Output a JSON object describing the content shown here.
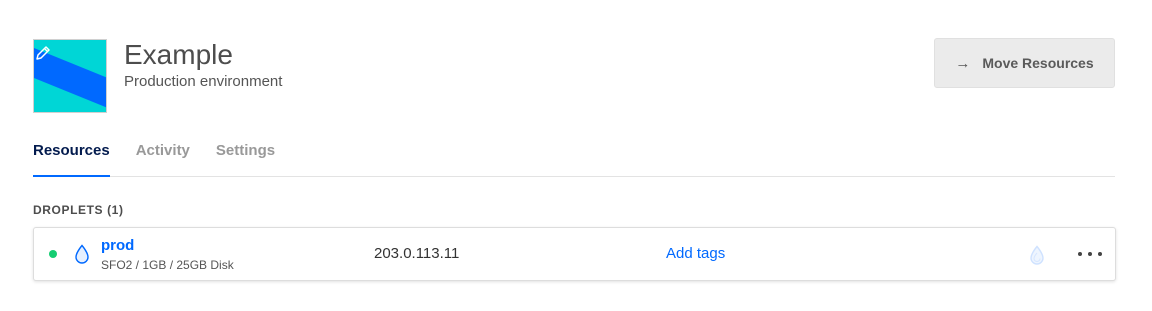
{
  "project": {
    "title": "Example",
    "subtitle": "Production environment",
    "avatar_colors": {
      "band": "#0069ff",
      "bg": "#00d6d6"
    },
    "edit_icon": "pencil-icon"
  },
  "header": {
    "move_button_label": "Move Resources",
    "move_button_icon": "arrow-right-icon"
  },
  "tabs": [
    {
      "label": "Resources",
      "active": true
    },
    {
      "label": "Activity",
      "active": false
    },
    {
      "label": "Settings",
      "active": false
    }
  ],
  "droplets": {
    "section_label": "DROPLETS (1)",
    "items": [
      {
        "status": "active",
        "status_color": "#15cd72",
        "icon": "droplet-icon",
        "name": "prod",
        "spec": "SFO2 / 1GB / 25GB Disk",
        "ip": "203.0.113.11",
        "tags_link": "Add tags",
        "monitor_icon": "monitoring-droplet-icon",
        "menu_icon": "more-icon"
      }
    ]
  },
  "colors": {
    "accent": "#0069ff",
    "active_tab_text": "#031b4e"
  }
}
